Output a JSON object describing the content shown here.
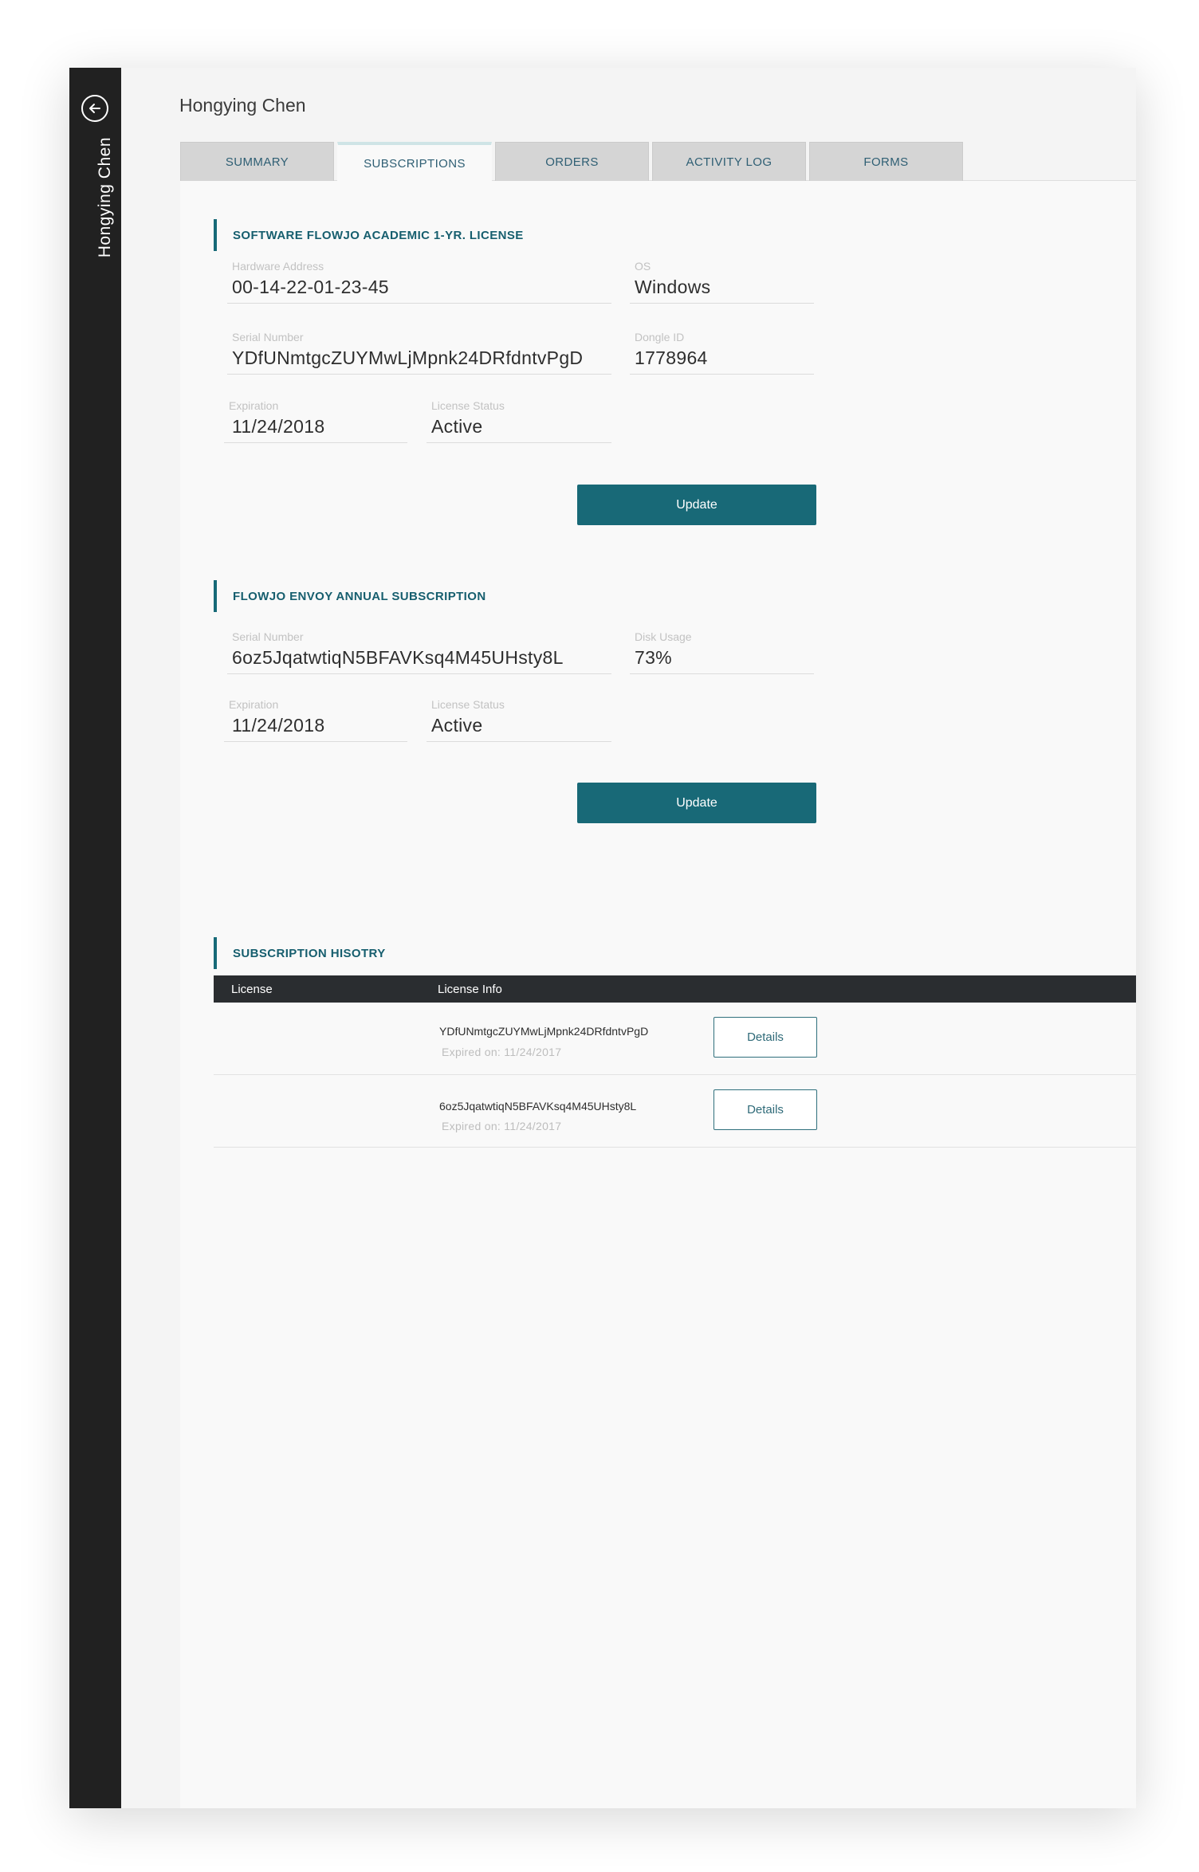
{
  "user": {
    "name": "Hongying Chen"
  },
  "tabs": [
    {
      "label": "SUMMARY"
    },
    {
      "label": "SUBSCRIPTIONS"
    },
    {
      "label": "ORDERS"
    },
    {
      "label": "ACTIVITY LOG"
    },
    {
      "label": "FORMS"
    }
  ],
  "active_tab": "SUBSCRIPTIONS",
  "license_section": {
    "title": "SOFTWARE FLOWJO ACADEMIC 1-YR. LICENSE",
    "hardware_address": {
      "label": "Hardware Address",
      "value": "00-14-22-01-23-45"
    },
    "os": {
      "label": "OS",
      "value": "Windows"
    },
    "serial_number": {
      "label": "Serial Number",
      "value": "YDfUNmtgcZUYMwLjMpnk24DRfdntvPgD"
    },
    "dongle_id": {
      "label": "Dongle ID",
      "value": "1778964"
    },
    "expiration": {
      "label": "Expiration",
      "value": "11/24/2018"
    },
    "license_status": {
      "label": "License Status",
      "value": "Active"
    },
    "update_label": "Update"
  },
  "envoy_section": {
    "title": "FLOWJO ENVOY ANNUAL SUBSCRIPTION",
    "serial_number": {
      "label": "Serial Number",
      "value": "6oz5JqatwtiqN5BFAVKsq4M45UHsty8L"
    },
    "disk_usage": {
      "label": "Disk Usage",
      "value": "73%"
    },
    "expiration": {
      "label": "Expiration",
      "value": "11/24/2018"
    },
    "license_status": {
      "label": "License Status",
      "value": "Active"
    },
    "update_label": "Update"
  },
  "history": {
    "title": "SUBSCRIPTION HISOTRY",
    "columns": [
      "License",
      "License Info"
    ],
    "rows": [
      {
        "serial": "YDfUNmtgcZUYMwLjMpnk24DRfdntvPgD",
        "expired": "Expired on: 11/24/2017",
        "action": "Details"
      },
      {
        "serial": "6oz5JqatwtiqN5BFAVKsq4M45UHsty8L",
        "expired": "Expired on: 11/24/2017",
        "action": "Details"
      }
    ]
  },
  "colors": {
    "sidebar": "#212121",
    "accent": "#186977",
    "section_title": "#165e6e",
    "table_header": "#2a2d30"
  },
  "icons": {
    "back": "arrow-left-circle-icon"
  }
}
